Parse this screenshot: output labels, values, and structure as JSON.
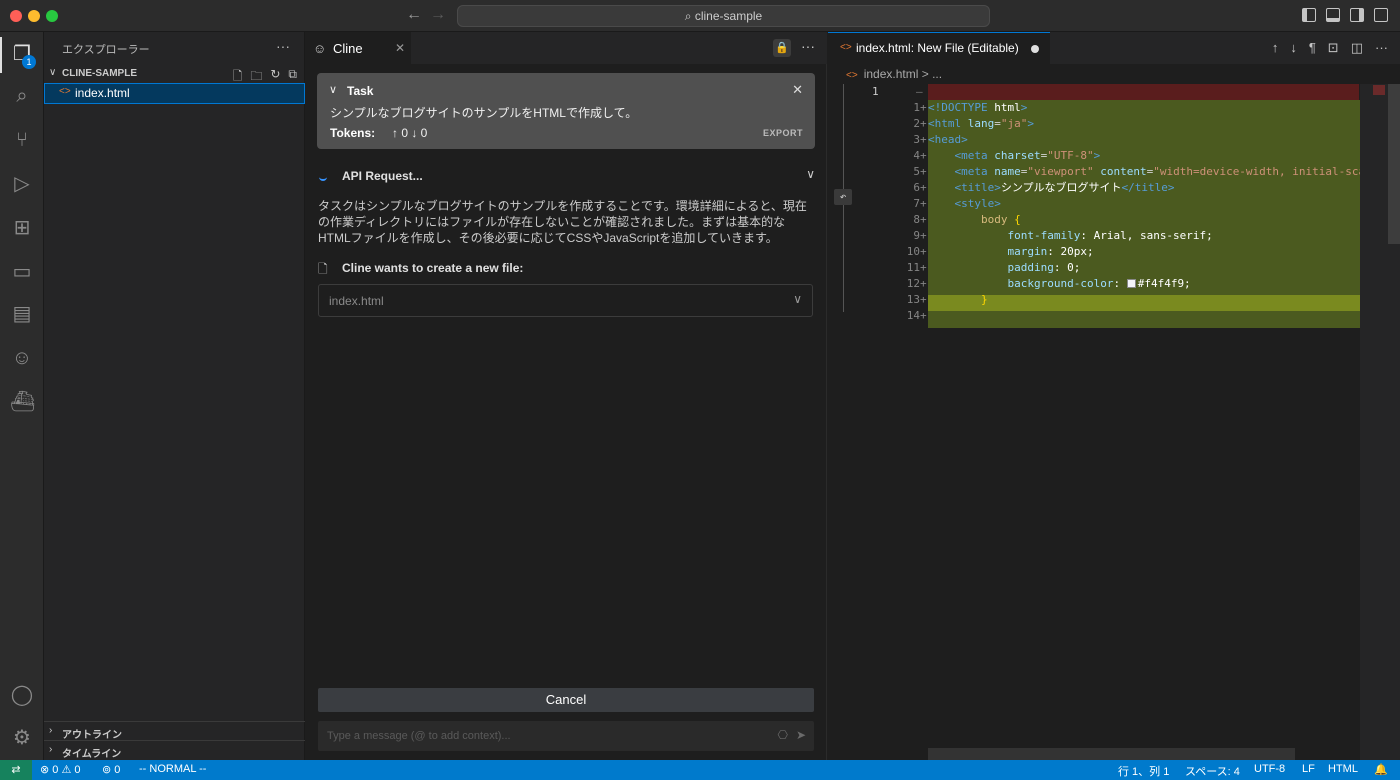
{
  "window": {
    "command_center": "cline-sample"
  },
  "activity_bar": {
    "explorer_badge": "1"
  },
  "explorer": {
    "header": "エクスプローラー",
    "more": "···",
    "folder_name": "CLINE-SAMPLE",
    "files": [
      {
        "name": "index.html",
        "icon": "html-file-icon"
      }
    ],
    "sections": [
      {
        "label": "アウトライン"
      },
      {
        "label": "タイムライン"
      }
    ]
  },
  "cline": {
    "tab_label": "Cline",
    "task": {
      "title": "Task",
      "description": "シンプルなブログサイトのサンプルをHTMLで作成して。",
      "tokens_label": "Tokens:",
      "tokens_value": "↑ 0 ↓ 0",
      "export_label": "EXPORT"
    },
    "api_request_label": "API Request...",
    "paragraph": "タスクはシンプルなブログサイトのサンプルを作成することです。環境詳細によると、現在の作業ディレクトリにはファイルが存在しないことが確認されました。まずは基本的なHTMLファイルを作成し、その後必要に応じてCSSやJavaScriptを追加していきます。",
    "wants_label": "Cline wants to create a new file:",
    "file_select_value": "index.html",
    "cancel_label": "Cancel",
    "input_placeholder": "Type a message (@ to add context)..."
  },
  "editor": {
    "tab_label": "index.html: New File (Editable)",
    "breadcrumb_file": "index.html",
    "breadcrumb_rest": "> ...",
    "original_line_number": "1",
    "lines": [
      {
        "n": "1"
      },
      {
        "n": "2"
      },
      {
        "n": "3"
      },
      {
        "n": "4"
      },
      {
        "n": "5"
      },
      {
        "n": "6"
      },
      {
        "n": "7"
      },
      {
        "n": "8"
      },
      {
        "n": "9"
      },
      {
        "n": "10"
      },
      {
        "n": "11"
      },
      {
        "n": "12"
      },
      {
        "n": "13"
      },
      {
        "n": "14"
      }
    ],
    "code": {
      "l1_tag": "<!DOCTYPE",
      "l1_rest": " html",
      "l1_end": ">",
      "l2_tag": "<html",
      "l2_attr": " lang",
      "l2_eq": "=",
      "l2_str": "\"ja\"",
      "l2_end": ">",
      "l3": "<head>",
      "l4_tag": "<meta",
      "l4_attr": " charset",
      "l4_eq": "=",
      "l4_str": "\"UTF-8\"",
      "l4_end": ">",
      "l5_tag": "<meta",
      "l5_attr1": " name",
      "l5_eq1": "=",
      "l5_str1": "\"viewport\"",
      "l5_attr2": " content",
      "l5_eq2": "=",
      "l5_str2": "\"width=device-width, initial-scale",
      "l6_open": "<title>",
      "l6_text": "シンプルなブログサイト",
      "l6_close": "</title>",
      "l7": "<style>",
      "l8_sel": "body",
      "l8_brace": " {",
      "l9_prop": "font-family",
      "l9_val": ": Arial, sans-serif;",
      "l10_prop": "margin",
      "l10_val": ": 20px;",
      "l11_prop": "padding",
      "l11_val": ": 0;",
      "l12_prop": "background-color",
      "l12_colon": ": ",
      "l12_val": "#f4f4f9;",
      "l13_brace": "}"
    },
    "swatch_color": "#f4f4f9"
  },
  "status_bar": {
    "errors": "0",
    "warnings": "0",
    "ports": "0",
    "mode": "-- NORMAL --",
    "position": "行 1、列 1",
    "spaces": "スペース: 4",
    "encoding": "UTF-8",
    "eol": "LF",
    "language": "HTML"
  }
}
